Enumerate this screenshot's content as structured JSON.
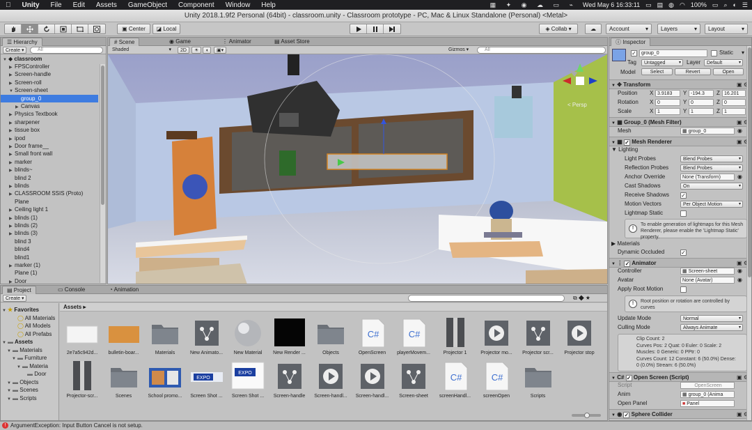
{
  "menubar": {
    "app": "Unity",
    "items": [
      "File",
      "Edit",
      "Assets",
      "GameObject",
      "Component",
      "Window",
      "Help"
    ],
    "clock": "Wed May 6  16:33:11",
    "battery": "100%"
  },
  "window_title": "Unity 2018.1.9f2 Personal (64bit) - classroom.unity - Classroom prototype - PC, Mac & Linux Standalone (Personal) <Metal>",
  "toolbar": {
    "pivot": "Center",
    "space": "Local",
    "collab": "Collab ▾",
    "account": "Account",
    "layers": "Layers",
    "layout": "Layout"
  },
  "hierarchy": {
    "tab": "Hierarchy",
    "create": "Create ▾",
    "search_placeholder": "All",
    "scene": "classroom",
    "rows": [
      {
        "label": "FPSController",
        "indent": 1,
        "arrow": "▶",
        "sel": false
      },
      {
        "label": "Screen-handle",
        "indent": 1,
        "arrow": "▶",
        "sel": false
      },
      {
        "label": "Screen-roll",
        "indent": 1,
        "arrow": "▶",
        "sel": false
      },
      {
        "label": "Screen-sheet",
        "indent": 1,
        "arrow": "▼",
        "sel": false
      },
      {
        "label": "group_0",
        "indent": 2,
        "arrow": "",
        "sel": true
      },
      {
        "label": "Canvas",
        "indent": 2,
        "arrow": "▶",
        "sel": false
      },
      {
        "label": "Physics Textbook",
        "indent": 1,
        "arrow": "▶",
        "sel": false
      },
      {
        "label": "sharpener",
        "indent": 1,
        "arrow": "▶",
        "sel": false
      },
      {
        "label": "tissue box",
        "indent": 1,
        "arrow": "▶",
        "sel": false
      },
      {
        "label": "ipod",
        "indent": 1,
        "arrow": "▶",
        "sel": false
      },
      {
        "label": "Door frame__",
        "indent": 1,
        "arrow": "▶",
        "sel": false
      },
      {
        "label": "Small front wall",
        "indent": 1,
        "arrow": "▶",
        "sel": false
      },
      {
        "label": "marker",
        "indent": 1,
        "arrow": "▶",
        "sel": false
      },
      {
        "label": "blinds~",
        "indent": 1,
        "arrow": "▶",
        "sel": false
      },
      {
        "label": "blind 2",
        "indent": 1,
        "arrow": "",
        "sel": false
      },
      {
        "label": "blinds",
        "indent": 1,
        "arrow": "▶",
        "sel": false
      },
      {
        "label": "CLASSROOM SSIS (Proto)",
        "indent": 1,
        "arrow": "▶",
        "sel": false
      },
      {
        "label": "Plane",
        "indent": 1,
        "arrow": "",
        "sel": false
      },
      {
        "label": "Ceiling light 1",
        "indent": 1,
        "arrow": "▶",
        "sel": false
      },
      {
        "label": "blinds (1)",
        "indent": 1,
        "arrow": "▶",
        "sel": false
      },
      {
        "label": "blinds (2)",
        "indent": 1,
        "arrow": "▶",
        "sel": false
      },
      {
        "label": "blinds (3)",
        "indent": 1,
        "arrow": "▶",
        "sel": false
      },
      {
        "label": "blind 3",
        "indent": 1,
        "arrow": "",
        "sel": false
      },
      {
        "label": "blind4",
        "indent": 1,
        "arrow": "",
        "sel": false
      },
      {
        "label": "blind1",
        "indent": 1,
        "arrow": "",
        "sel": false
      },
      {
        "label": "marker (1)",
        "indent": 1,
        "arrow": "▶",
        "sel": false
      },
      {
        "label": "Plane (1)",
        "indent": 1,
        "arrow": "",
        "sel": false
      },
      {
        "label": "Door",
        "indent": 1,
        "arrow": "▶",
        "sel": false
      }
    ]
  },
  "scene": {
    "tabs": [
      "Scene",
      "Game",
      "Animator",
      "Asset Store"
    ],
    "shaded": "Shaded",
    "mode2d": "2D",
    "gizmos": "Gizmos ▾",
    "search_placeholder": "All",
    "persp": "< Persp"
  },
  "project": {
    "tabs": [
      "Project",
      "Console",
      "Animation"
    ],
    "create": "Create ▾",
    "breadcrumb": "Assets ▸",
    "tree": [
      {
        "label": "Favorites",
        "indent": 0,
        "type": "fav-header"
      },
      {
        "label": "All Materials",
        "indent": 2,
        "type": "search"
      },
      {
        "label": "All Models",
        "indent": 2,
        "type": "search"
      },
      {
        "label": "All Prefabs",
        "indent": 2,
        "type": "search"
      },
      {
        "label": "Assets",
        "indent": 0,
        "type": "folder-header"
      },
      {
        "label": "Materials",
        "indent": 1,
        "type": "folder"
      },
      {
        "label": "Furniture",
        "indent": 2,
        "type": "folder"
      },
      {
        "label": "Materia",
        "indent": 3,
        "type": "folder"
      },
      {
        "label": "Door",
        "indent": 4,
        "type": "folder"
      },
      {
        "label": "Objects",
        "indent": 1,
        "type": "folder"
      },
      {
        "label": "Scenes",
        "indent": 1,
        "type": "folder"
      },
      {
        "label": "Scripts",
        "indent": 1,
        "type": "folder"
      }
    ],
    "assets": [
      {
        "label": "2e7a5c942d...",
        "kind": "white"
      },
      {
        "label": "bulletin-boar...",
        "kind": "orange"
      },
      {
        "label": "Materials",
        "kind": "folder"
      },
      {
        "label": "New Animato...",
        "kind": "animator"
      },
      {
        "label": "New Material",
        "kind": "sphere"
      },
      {
        "label": "New Render ...",
        "kind": "black"
      },
      {
        "label": "Objects",
        "kind": "folder"
      },
      {
        "label": "OpenScreen",
        "kind": "cs"
      },
      {
        "label": "playerMovem...",
        "kind": "cs"
      },
      {
        "label": "Projector 1",
        "kind": "projector"
      },
      {
        "label": "Projector mo...",
        "kind": "anim"
      },
      {
        "label": "Projector scr...",
        "kind": "animator"
      },
      {
        "label": "Projector stop",
        "kind": "anim"
      },
      {
        "label": "Projector-scr...",
        "kind": "projector"
      },
      {
        "label": "Scenes",
        "kind": "folder"
      },
      {
        "label": "School promo...",
        "kind": "promo"
      },
      {
        "label": "Screen Shot ...",
        "kind": "expo"
      },
      {
        "label": "Screen Shot ...",
        "kind": "expo2"
      },
      {
        "label": "Screen-handle",
        "kind": "animator"
      },
      {
        "label": "Screen-handl...",
        "kind": "anim"
      },
      {
        "label": "Screen-handl...",
        "kind": "anim"
      },
      {
        "label": "Screen-sheet",
        "kind": "animator"
      },
      {
        "label": "screenHandl...",
        "kind": "cs"
      },
      {
        "label": "screenOpen",
        "kind": "cs"
      },
      {
        "label": "Scripts",
        "kind": "folder"
      }
    ]
  },
  "inspector": {
    "tab": "Inspector",
    "name": "group_0",
    "static": "Static",
    "tag_label": "Tag",
    "tag": "Untagged",
    "layer_label": "Layer",
    "layer": "Default",
    "model_label": "Model",
    "select": "Select",
    "revert": "Revert",
    "open": "Open",
    "transform": {
      "title": "Transform",
      "position": "Position",
      "rotation": "Rotation",
      "scale": "Scale",
      "pos": [
        "3.9183",
        "-194.3",
        "16.201"
      ],
      "rot": [
        "0",
        "0",
        "0"
      ],
      "scl": [
        "1",
        "1",
        "1"
      ],
      "x": "X",
      "y": "Y",
      "z": "Z"
    },
    "meshfilter": {
      "title": "Group_0 (Mesh Filter)",
      "mesh_label": "Mesh",
      "mesh": "group_0"
    },
    "meshrenderer": {
      "title": "Mesh Renderer",
      "lighting": "Lighting",
      "light_probes_label": "Light Probes",
      "light_probes": "Blend Probes",
      "refl_label": "Reflection Probes",
      "refl": "Blend Probes",
      "anchor_label": "Anchor Override",
      "anchor": "None (Transform)",
      "cast_label": "Cast Shadows",
      "cast": "On",
      "receive_label": "Receive Shadows",
      "motion_label": "Motion Vectors",
      "motion": "Per Object Motion",
      "lmstatic_label": "Lightmap Static",
      "info": "To enable generation of lightmaps for this Mesh Renderer, please enable the 'Lightmap Static' property.",
      "materials": "Materials",
      "dyn_label": "Dynamic Occluded"
    },
    "animator": {
      "title": "Animator",
      "controller_label": "Controller",
      "controller": "Screen-sheet",
      "avatar_label": "Avatar",
      "avatar": "None (Avatar)",
      "apply_label": "Apply Root Motion",
      "info": "Root position or rotation are controlled by curves",
      "update_label": "Update Mode",
      "update": "Normal",
      "culling_label": "Culling Mode",
      "culling": "Always Animate",
      "clip_info": [
        "Clip Count: 2",
        "Curves Pos: 2 Quat: 0 Euler: 0 Scale: 2",
        "Muscles: 0 Generic: 0 PPtr: 0",
        "Curves Count: 12 Constant: 6 (50.0%) Dense:",
        "0 (0.0%) Stream: 6 (50.0%)"
      ]
    },
    "openscreen": {
      "title": "Open Screen (Script)",
      "script_label": "Script",
      "script": "OpenScreen",
      "anim_label": "Anim",
      "anim": "group_0 (Anima",
      "panel_label": "Open Panel",
      "panel": "Panel"
    },
    "sphere": {
      "title": "Sphere Collider"
    }
  },
  "status": {
    "message": "ArgumentException: Input Button Cancel is not setup."
  }
}
